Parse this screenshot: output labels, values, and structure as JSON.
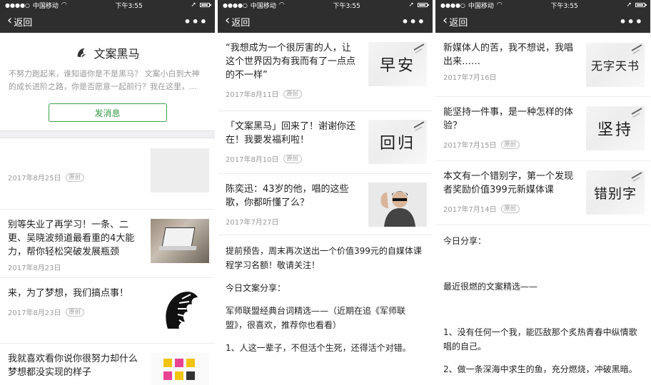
{
  "status": {
    "carrier": "中国移动",
    "time": "下午3:55"
  },
  "nav": {
    "back_label": "返回",
    "more_label": "•••"
  },
  "colors": {
    "bar": "#2e2e2e",
    "green": "#2f9a41"
  },
  "screens": [
    {
      "profile": {
        "name": "文案黑马",
        "description": "不努力跑起来，谁知道你是不是黑马？ 文案小白到大神的成长进阶之路，你是否愿意一起前行？我在这里，...",
        "message_button": "发消息"
      },
      "articles": [
        {
          "title": "",
          "date": "2017年8月25日",
          "badge": "原创",
          "thumb": "grey"
        },
        {
          "title": "别等失业了再学习！一条、二更、吴晓波频道最看重的4大能力，帮你轻松突破发展瓶颈",
          "date": "2017年8月23日",
          "badge": "",
          "thumb": "laptop"
        },
        {
          "title": "来，为了梦想，我们搞点事！",
          "date": "2017年8月23日",
          "badge": "原创",
          "thumb": "zebra"
        },
        {
          "title": "我就喜欢看你说你很努力却什么梦想都没实现的样子",
          "date": "",
          "badge": "",
          "thumb": "books"
        }
      ]
    },
    {
      "articles": [
        {
          "title": "“我想成为一个很厉害的人，让这个世界因为有我而有了一点点的不一样”",
          "date": "2017年8月11日",
          "badge": "原创",
          "thumb_text": "早安"
        },
        {
          "title": "「文案黑马」回来了！谢谢你还在！我要发福利啦！",
          "date": "2017年8月10日",
          "badge": "原创",
          "thumb_text": "回归"
        },
        {
          "title": "陈奕迅：43岁的他，唱的这些歌，你都听懂了么？",
          "date": "2017年7月27日",
          "badge": "",
          "thumb": "person"
        }
      ],
      "body": [
        "提前预告，周末再次送出一个价值399元的自媒体课程学习名额！敬请关注！",
        "今日文案分享：",
        "军师联盟经典台词精选——（近期在追《军师联盟》，很喜欢，推荐你也看看）",
        "1、人这一辈子，不但活个生死，还得活个对错。"
      ]
    },
    {
      "articles": [
        {
          "title": "新媒体人的苦，我不想说，我唱出来……",
          "date": "2017年7月16日",
          "badge": "",
          "thumb_text": "无字天书"
        },
        {
          "title": "能坚持一件事，是一种怎样的体验？",
          "date": "2017年7月15日",
          "badge": "原创",
          "thumb_text": "坚持"
        },
        {
          "title": "本文有一个错别字，第一个发现者奖励价值399元新媒体课",
          "date": "2017年7月14日",
          "badge": "原创",
          "thumb_text": "错别字"
        }
      ],
      "body": [
        "今日分享：",
        "最近很燃的文案精选——",
        "1、没有任何一个我，能匹敌那个炙热青春中纵情歌唱的自己。",
        "2、做一条深海中求生的鱼，充分燃烧，冲破黑暗。"
      ]
    }
  ]
}
